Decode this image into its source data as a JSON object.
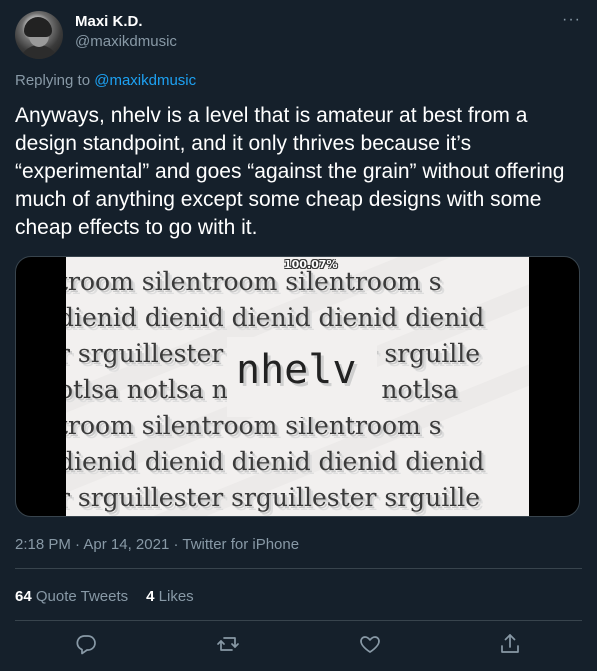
{
  "author": {
    "name": "Maxi K.D.",
    "handle": "@maxikdmusic"
  },
  "more_label": "···",
  "reply": {
    "prefix": "Replying to",
    "mention": "@maxikdmusic"
  },
  "tweet_text": "Anyways, nhelv is a level that is amateur at best from a design standpoint, and it only thrives because it’s “experimental” and goes “against the grain” without offering much of anything except some cheap designs with some cheap effects to go with it.",
  "media": {
    "percent": "100.07%",
    "center_word": "nhelv",
    "rows": [
      "troom   silentroom   silentroom   s",
      "dienid  dienid  dienid  dienid  dienid",
      "r  srguillester  srguillester  srguille",
      "otlsa  notlsa  notlsa  notlsa  notlsa",
      "troom   silentroom   silentroom   s",
      "dienid  dienid  dienid  dienid  dienid",
      "r  srguillester  srguillester  srguille"
    ]
  },
  "meta": {
    "time": "2:18 PM",
    "sep": " · ",
    "date": "Apr 14, 2021",
    "source": "Twitter for iPhone"
  },
  "stats": {
    "quote_count": "64",
    "quote_label": "Quote Tweets",
    "like_count": "4",
    "like_label": "Likes"
  },
  "actions": [
    "reply-icon",
    "retweet-icon",
    "like-icon",
    "share-icon"
  ],
  "colors": {
    "background": "#15202b",
    "accent": "#1da1f2",
    "muted": "#8899a6",
    "border": "#38444d"
  }
}
